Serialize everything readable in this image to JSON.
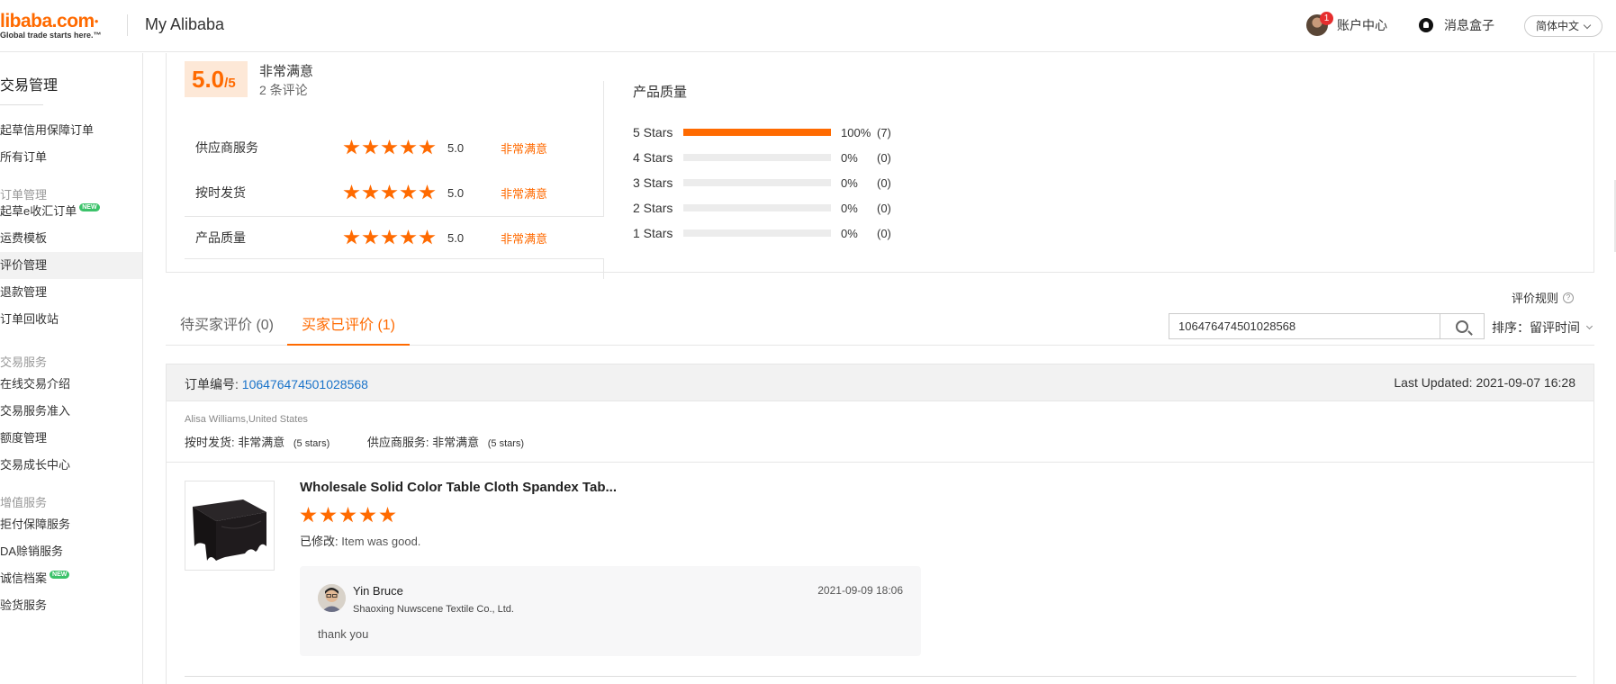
{
  "header": {
    "logo_main": "libaba.com",
    "logo_tagline": "Global trade starts here.™",
    "title": "My Alibaba",
    "account_badge": "1",
    "account_label": "账户中心",
    "messages_label": "消息盒子",
    "language": "简体中文"
  },
  "sidebar": {
    "title": "交易管理",
    "items": [
      {
        "label": "起草信用保障订单"
      },
      {
        "label": "所有订单"
      },
      {
        "group": "订单管理"
      },
      {
        "label": "起草e收汇订单",
        "badge": "NEW"
      },
      {
        "label": "运费模板"
      },
      {
        "label": "评价管理",
        "active": true
      },
      {
        "label": "退款管理"
      },
      {
        "label": "订单回收站"
      },
      {
        "group": "交易服务"
      },
      {
        "label": "在线交易介绍"
      },
      {
        "label": "交易服务准入"
      },
      {
        "label": "额度管理"
      },
      {
        "label": "交易成长中心"
      },
      {
        "group": "增值服务"
      },
      {
        "label": "拒付保障服务"
      },
      {
        "label": "DA赊销服务"
      },
      {
        "label": "诚信档案",
        "badge": "NEW"
      },
      {
        "label": "验货服务"
      }
    ]
  },
  "summary": {
    "score": "5.0",
    "score_suffix": "/5",
    "level": "非常满意",
    "count": "2 条评论",
    "dimensions": [
      {
        "label": "供应商服务",
        "stars": 5,
        "value": "5.0",
        "level": "非常满意"
      },
      {
        "label": "按时发货",
        "stars": 5,
        "value": "5.0",
        "level": "非常满意"
      },
      {
        "label": "产品质量",
        "stars": 5,
        "value": "5.0",
        "level": "非常满意"
      }
    ],
    "histogram_title": "产品质量",
    "histogram": [
      {
        "label": "5  Stars",
        "fraction": 1.0,
        "pct": "100%",
        "count": "(7)"
      },
      {
        "label": "4  Stars",
        "fraction": 0,
        "pct": "0%",
        "count": "(0)"
      },
      {
        "label": "3  Stars",
        "fraction": 0,
        "pct": "0%",
        "count": "(0)"
      },
      {
        "label": "2  Stars",
        "fraction": 0,
        "pct": "0%",
        "count": "(0)"
      },
      {
        "label": "1  Stars",
        "fraction": 0,
        "pct": "0%",
        "count": "(0)"
      }
    ]
  },
  "toolbar": {
    "rule_link": "评价规则",
    "tabs": [
      {
        "label": "待买家评价 (0)",
        "active": false
      },
      {
        "label": "买家已评价 (1)",
        "active": true
      }
    ],
    "search_value": "106476474501028568",
    "sort_label": "排序：留评时间"
  },
  "order": {
    "number_label": "订单编号:",
    "number": "106476474501028568",
    "updated": "Last Updated: 2021-09-07 16:28",
    "buyer": "Alisa Williams,United States",
    "ship_label": "按时发货:",
    "ship_level": "非常满意",
    "ship_stars": "(5 stars)",
    "service_label": "供应商服务:",
    "service_level": "非常满意",
    "service_stars": "(5 stars)",
    "product_title": "Wholesale Solid Color Table Cloth Spandex Tab...",
    "product_stars": 5,
    "comment_label": "已修改:",
    "comment": "Item was good.",
    "reply": {
      "name": "Yin Bruce",
      "company": "Shaoxing Nuwscene Textile Co., Ltd.",
      "time": "2021-09-09 18:06",
      "text": "thank you"
    }
  },
  "colors": {
    "accent": "#ff6a00",
    "link": "#1a73c9",
    "new_badge": "#3cc26a"
  }
}
